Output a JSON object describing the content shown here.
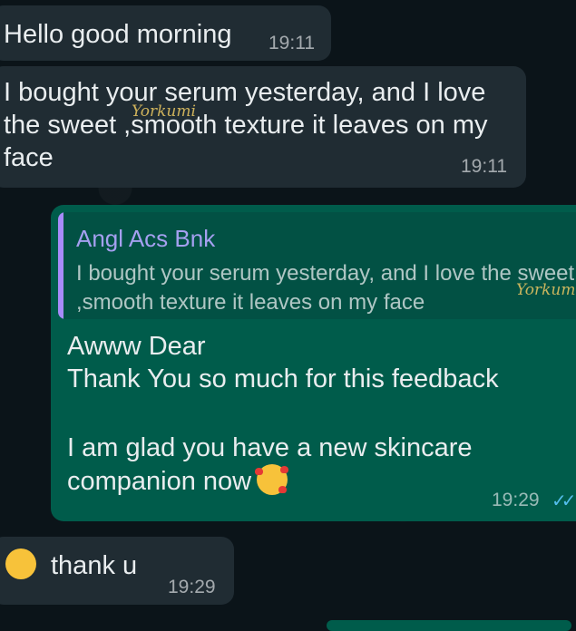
{
  "messages": [
    {
      "type": "incoming",
      "text": "Hello good morning",
      "time": "19:11"
    },
    {
      "type": "incoming",
      "text": "I bought your serum yesterday, and I love the sweet ,smooth texture it leaves on my face",
      "time": "19:11"
    },
    {
      "type": "outgoing",
      "quote": {
        "sender": "Angl Acs Bnk",
        "text": "I bought your serum yesterday, and I love the sweet ,smooth texture it leaves on my face"
      },
      "lines": [
        "Awww Dear",
        "Thank You so much for this feedback",
        "",
        "I am glad you have a new skincare companion now"
      ],
      "emoji": "smiling-face-with-hearts",
      "time": "19:29",
      "status": "read"
    },
    {
      "type": "incoming",
      "emoji": "heart-eyes",
      "text": "thank u",
      "time": "19:29"
    }
  ],
  "watermark": "Yorkumi",
  "colors": {
    "incoming": "#202c33",
    "outgoing": "#005c4b",
    "read_ticks": "#53bdeb",
    "quote_sender": "#a5a0f0"
  }
}
